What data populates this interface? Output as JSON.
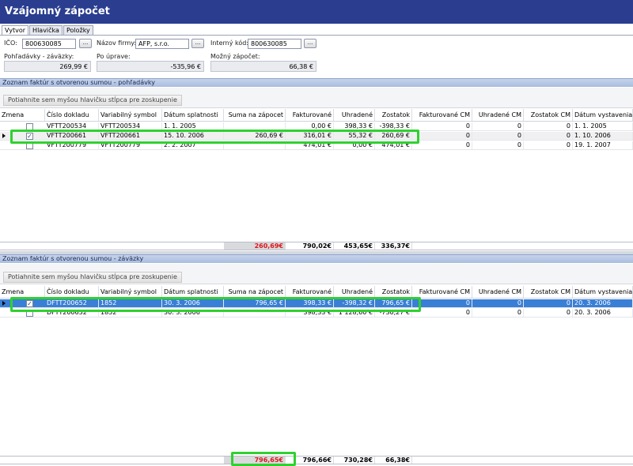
{
  "window": {
    "title": "Vzájomný zápočet"
  },
  "tabs": [
    "Vytvor",
    "Hlavička",
    "Položky"
  ],
  "form": {
    "ico_label": "IČO:",
    "ico_value": "800630085",
    "firma_label": "Názov firmy:",
    "firma_value": "AFP, s.r.o.",
    "kod_label": "Interný kód:",
    "kod_value": "800630085",
    "browse": "...",
    "pohl_label": "Pohľadávky - záväzky:",
    "pohl_value": "269,99 €",
    "uprave_label": "Po úprave:",
    "uprave_value": "-535,96 €",
    "mozny_label": "Možný zápočet:",
    "mozny_value": "66,38 €"
  },
  "group_hint": "Potiahnite sem myšou hlavičku stĺpca pre zoskupenie",
  "columns": [
    "Zmena",
    "Číslo dokladu",
    "Variabilný symbol",
    "Dátum splatnosti",
    "Suma na zápocet",
    "Fakturované",
    "Uhradené",
    "Zostatok",
    "Fakturované CM",
    "Uhradené CM",
    "Zostatok CM",
    "Dátum vystavenia"
  ],
  "receivables": {
    "title": "Zoznam faktúr s otvorenou sumou - pohľadávky",
    "rows": [
      {
        "checked": "",
        "doc": "VFTT200534",
        "vs": "VFTT200534",
        "due": "1. 1. 2005",
        "sum": "",
        "fakt": "0,00 €",
        "uhr": "398,33 €",
        "zost": "-398,33 €",
        "fcm": "0",
        "ucm": "0",
        "zcm": "0",
        "vyst": "1. 1. 2005"
      },
      {
        "checked": "✓",
        "doc": "VFTT200661",
        "vs": "VFTT200661",
        "due": "15. 10. 2006",
        "sum": "260,69 €",
        "fakt": "316,01 €",
        "uhr": "55,32 €",
        "zost": "260,69 €",
        "fcm": "0",
        "ucm": "0",
        "zcm": "0",
        "vyst": "1. 10. 2006"
      },
      {
        "checked": "",
        "doc": "VFTT200779",
        "vs": "VFTT200779",
        "due": "2. 2. 2007",
        "sum": "",
        "fakt": "474,01 €",
        "uhr": "0,00 €",
        "zost": "474,01 €",
        "fcm": "0",
        "ucm": "0",
        "zcm": "0",
        "vyst": "19. 1. 2007"
      }
    ],
    "totals": {
      "sum": "260,69€",
      "fakt": "790,02€",
      "uhr": "453,65€",
      "zost": "336,37€"
    }
  },
  "payables": {
    "title": "Zoznam faktúr s otvorenou sumou - záväzky",
    "rows": [
      {
        "checked": "✓",
        "doc": "DFTT200652",
        "vs": "1852",
        "due": "30. 3. 2006",
        "sum": "796,65 €",
        "fakt": "398,33 €",
        "uhr": "-398,32 €",
        "zost": "796,65 €",
        "fcm": "0",
        "ucm": "0",
        "zcm": "0",
        "vyst": "20. 3. 2006"
      },
      {
        "checked": "",
        "doc": "DFTT200652",
        "vs": "1852",
        "due": "30. 3. 2006",
        "sum": "",
        "fakt": "398,33 €",
        "uhr": "1 128,60 €",
        "zost": "-730,27 €",
        "fcm": "0",
        "ucm": "0",
        "zcm": "0",
        "vyst": "20. 3. 2006"
      }
    ],
    "totals": {
      "sum": "796,65€",
      "fakt": "796,66€",
      "uhr": "730,28€",
      "zost": "66,38€"
    }
  }
}
